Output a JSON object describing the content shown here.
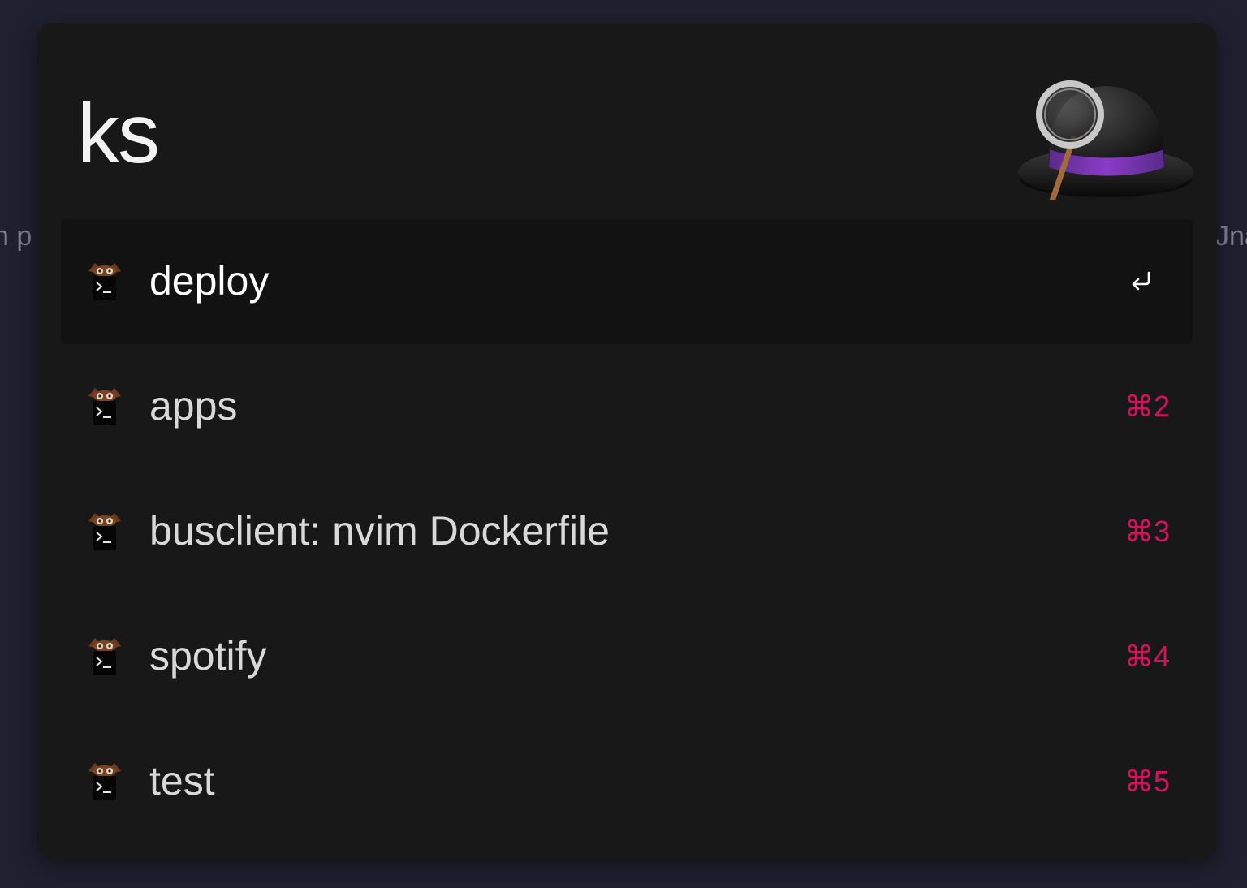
{
  "backdrop": {
    "left_text": "n  p",
    "right_text": "Jna"
  },
  "launcher": {
    "query": "ks",
    "logo_icon": "alfred-hat-icon",
    "accent_color": "#d1135a",
    "results": [
      {
        "title": "deploy",
        "shortcut": "",
        "selected": true,
        "icon": "terminal-workflow-icon"
      },
      {
        "title": "apps",
        "shortcut": "⌘2",
        "selected": false,
        "icon": "terminal-workflow-icon"
      },
      {
        "title": "busclient: nvim Dockerfile",
        "shortcut": "⌘3",
        "selected": false,
        "icon": "terminal-workflow-icon"
      },
      {
        "title": "spotify",
        "shortcut": "⌘4",
        "selected": false,
        "icon": "terminal-workflow-icon"
      },
      {
        "title": "test",
        "shortcut": "⌘5",
        "selected": false,
        "icon": "terminal-workflow-icon"
      }
    ]
  }
}
